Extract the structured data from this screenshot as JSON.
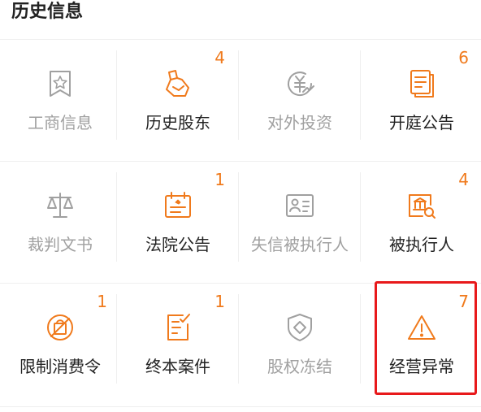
{
  "section_title": "历史信息",
  "colors": {
    "accent": "#f07a1c",
    "disabled": "#a0a0a0",
    "highlight": "#e8191b"
  },
  "items": [
    {
      "label": "工商信息",
      "count": "",
      "enabled": false,
      "icon": "bookmark-star-icon"
    },
    {
      "label": "历史股东",
      "count": "4",
      "enabled": true,
      "icon": "shareholder-icon"
    },
    {
      "label": "对外投资",
      "count": "",
      "enabled": false,
      "icon": "investment-icon"
    },
    {
      "label": "开庭公告",
      "count": "6",
      "enabled": true,
      "icon": "document-stack-icon"
    },
    {
      "label": "裁判文书",
      "count": "",
      "enabled": false,
      "icon": "scales-icon"
    },
    {
      "label": "法院公告",
      "count": "1",
      "enabled": true,
      "icon": "court-notice-icon"
    },
    {
      "label": "失信被执行人",
      "count": "",
      "enabled": false,
      "icon": "id-card-icon"
    },
    {
      "label": "被执行人",
      "count": "4",
      "enabled": true,
      "icon": "bank-search-icon"
    },
    {
      "label": "限制消费令",
      "count": "1",
      "enabled": true,
      "icon": "no-shopping-icon"
    },
    {
      "label": "终本案件",
      "count": "1",
      "enabled": true,
      "icon": "document-check-icon"
    },
    {
      "label": "股权冻结",
      "count": "",
      "enabled": false,
      "icon": "shield-diamond-icon"
    },
    {
      "label": "经营异常",
      "count": "7",
      "enabled": true,
      "icon": "warning-triangle-icon"
    }
  ]
}
